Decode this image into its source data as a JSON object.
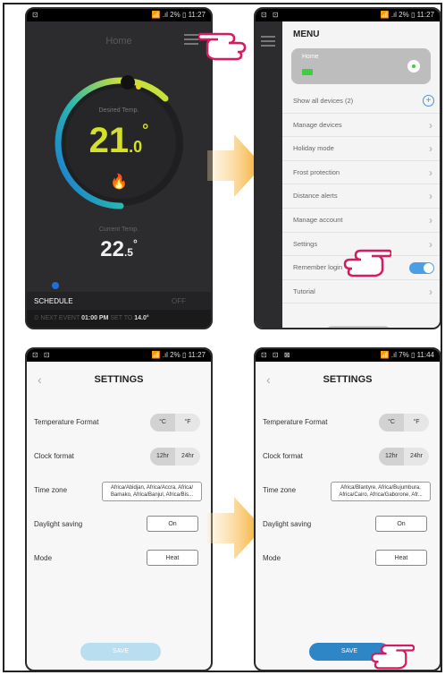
{
  "colors": {
    "accent_yellow": "#d4e02a",
    "toggle_blue": "#4a9ee6",
    "save_blue": "#2e86c6",
    "arrow_orange": "#f5b23a"
  },
  "phone1": {
    "status_left": "⊡",
    "status_right": "📶 .ıl 2% ▯ 11:27",
    "title": "Home",
    "desired_label": "Desired Temp.",
    "desired_int": "21",
    "desired_dec": ".0",
    "current_label": "Current Temp.",
    "current_int": "22",
    "current_dec": ".5",
    "degree": "°",
    "schedule_label": "SCHEDULE",
    "off_label": "OFF",
    "next_event_label": "NEXT EVENT",
    "next_event_time": "01:00 PM",
    "set_to_label": "SET TO",
    "set_to_value": "14.0°"
  },
  "phone2": {
    "status_left": "⊡ ⊡",
    "status_right": "📶 .ıl 2% ▯ 11:27",
    "menu_title": "MENU",
    "home_label": "Home",
    "items": [
      {
        "label": "Show all devices (2)",
        "icon": "plus"
      },
      {
        "label": "Manage devices",
        "icon": "chevron"
      },
      {
        "label": "Holiday mode",
        "icon": "chevron"
      },
      {
        "label": "Frost protection",
        "icon": "chevron"
      },
      {
        "label": "Distance alerts",
        "icon": "chevron"
      },
      {
        "label": "Manage account",
        "icon": "chevron"
      },
      {
        "label": "Settings",
        "icon": "chevron"
      },
      {
        "label": "Remember login",
        "icon": "toggle",
        "toggle_on": true
      },
      {
        "label": "Tutorial",
        "icon": "chevron"
      }
    ]
  },
  "phone3": {
    "status_left": "⊡ ⊡",
    "status_right": "📶 .ıl 2% ▯ 11:27",
    "title": "SETTINGS",
    "temp_format_label": "Temperature Format",
    "celsius": "°C",
    "fahrenheit": "°F",
    "clock_label": "Clock format",
    "h12": "12hr",
    "h24": "24hr",
    "timezone_label": "Time zone",
    "timezone_value": "Africa/Abidjan, Africa/Accra, Africa/ Bamako, Africa/Banjul, Africa/Bis...",
    "daylight_label": "Daylight saving",
    "daylight_value": "On",
    "mode_label": "Mode",
    "mode_value": "Heat",
    "save_label": "SAVE"
  },
  "phone4": {
    "status_left": "⊡ ⊡ ⊠",
    "status_right": "📶 .ıl 7% ▯ 11:44",
    "title": "SETTINGS",
    "temp_format_label": "Temperature Format",
    "celsius": "°C",
    "fahrenheit": "°F",
    "clock_label": "Clock format",
    "h12": "12hr",
    "h24": "24hr",
    "timezone_label": "Time zone",
    "timezone_value": "Africa/Blantyre, Africa/Bujumbura, Africa/Cairo, Africa/Gaborone, Afr...",
    "daylight_label": "Daylight saving",
    "daylight_value": "On",
    "mode_label": "Mode",
    "mode_value": "Heat",
    "save_label": "SAVE"
  }
}
